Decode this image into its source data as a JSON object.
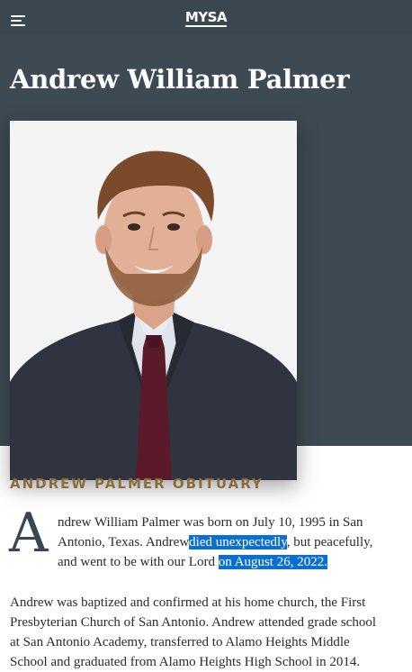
{
  "header": {
    "logo_text": "MYSA"
  },
  "page": {
    "title": "Andrew William Palmer"
  },
  "obituary": {
    "section_label": "ANDREW PALMER OBITUARY",
    "drop_cap": "A",
    "paragraph1": {
      "line1": "ndrew William Palmer was born on July 10, 1995 in San",
      "line2_a": "Antonio, Texas. Andrew",
      "line2_highlight": "died unexpectedly",
      "line2_b": ", but peacefully,",
      "line3_a": "and went to be with our Lord",
      "line3_highlight": "on August 26, 2022."
    },
    "paragraph2": {
      "line1": "Andrew was baptized and confirmed at his home church, the First",
      "line2": "Presbyterian Church of San Antonio. Andrew attended grade school",
      "line3": "at San Antonio Academy, transferred to Alamo Heights Middle",
      "line4": "School and graduated from Alamo Heights High School in 2014."
    }
  },
  "colors": {
    "header_bg": "#3a4750",
    "hero_bg": "#3d4a53",
    "label_gold": "#8a6d3b",
    "selection_highlight": "#0b6fd0"
  }
}
